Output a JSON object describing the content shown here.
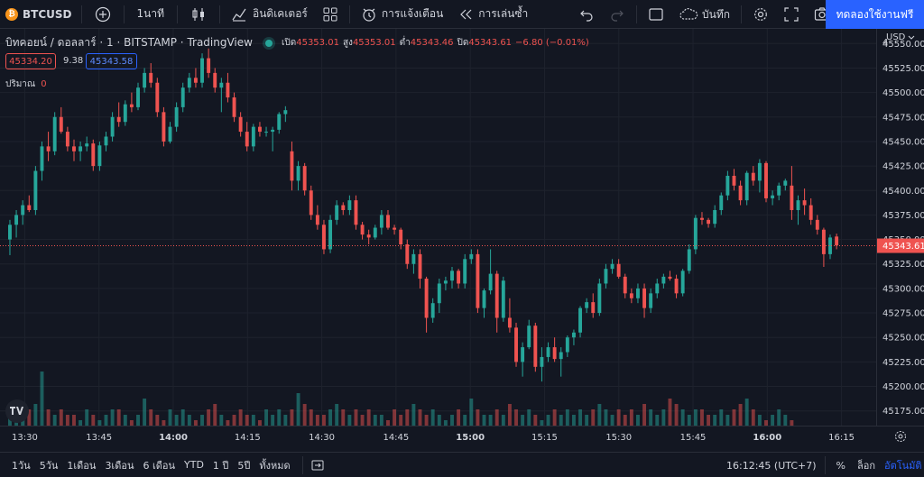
{
  "toolbar": {
    "symbol": "BTCUSD",
    "interval": "1นาที",
    "indicators_label": "อินดิเคเตอร์",
    "alerts_label": "การแจ้งเตือน",
    "replay_label": "การเล่นซ้ำ",
    "save_label": "บันทึก",
    "trial_button": "ทดลองใช้งานฟรี",
    "coin_glyph": "₿"
  },
  "legend": {
    "title": "บิทคอยน์ / ดอลลาร์ · 1 · BITSTAMP · TradingView",
    "open_label": "เปิด",
    "open": "45353.01",
    "high_label": "สูง",
    "high": "45353.01",
    "low_label": "ต่ำ",
    "low": "45343.46",
    "close_label": "ปิด",
    "close": "45343.61",
    "change": "−6.80 (−0.01%)",
    "bid": "45334.20",
    "spread": "9.38",
    "ask": "45343.58",
    "volume_label": "ปริมาณ",
    "volume_value": "0"
  },
  "price_axis": {
    "currency": "USD",
    "ticks": [
      "45550.00",
      "45525.00",
      "45500.00",
      "45475.00",
      "45450.00",
      "45425.00",
      "45400.00",
      "45375.00",
      "45350.00",
      "45325.00",
      "45300.00",
      "45275.00",
      "45250.00",
      "45225.00",
      "45200.00",
      "45175.00"
    ],
    "current_price": "45343.61",
    "top_partial": "4"
  },
  "time_axis": {
    "ticks": [
      "13:30",
      "13:45",
      "14:00",
      "14:15",
      "14:30",
      "14:45",
      "15:00",
      "15:15",
      "15:30",
      "15:45",
      "16:00",
      "16:15"
    ],
    "bold_ticks": [
      "14:00",
      "15:00",
      "16:00"
    ]
  },
  "bottom": {
    "ranges": [
      "1วัน",
      "5วัน",
      "1เดือน",
      "3เดือน",
      "6 เดือน",
      "YTD",
      "1 ปี",
      "5ปี",
      "ทั้งหมด"
    ],
    "clock": "16:12:45 (UTC+7)",
    "percent": "%",
    "log": "ล็อก",
    "auto": "อัตโนมัติ"
  },
  "colors": {
    "up": "#26a69a",
    "down": "#ef5350",
    "background": "#131722",
    "accent": "#2962ff"
  },
  "icons": [
    "plus-icon",
    "candles-icon",
    "indicators-icon",
    "templates-icon",
    "alert-icon",
    "replay-icon",
    "undo-icon",
    "redo-icon",
    "layout-icon",
    "cloud-icon",
    "gear-icon",
    "fullscreen-icon",
    "camera-icon",
    "goto-date-icon",
    "axis-settings-icon",
    "tradingview-logo"
  ],
  "chart_data": {
    "type": "candlestick",
    "x_range": [
      "13:25",
      "16:22"
    ],
    "ylim": [
      45160,
      45565
    ],
    "price_line": 45343.61,
    "candles": [
      [
        45350,
        45370,
        45334,
        45365
      ],
      [
        45365,
        45380,
        45352,
        45375
      ],
      [
        45375,
        45390,
        45365,
        45385
      ],
      [
        45385,
        45395,
        45378,
        45380
      ],
      [
        45380,
        45425,
        45375,
        45420
      ],
      [
        45420,
        45450,
        45410,
        45445
      ],
      [
        45445,
        45460,
        45430,
        45440
      ],
      [
        45440,
        45480,
        45436,
        45475
      ],
      [
        45475,
        45485,
        45458,
        45460
      ],
      [
        45460,
        45465,
        45440,
        45445
      ],
      [
        45445,
        45452,
        45430,
        45440
      ],
      [
        45440,
        45450,
        45430,
        45445
      ],
      [
        45445,
        45455,
        45440,
        45448
      ],
      [
        45448,
        45452,
        45420,
        45425
      ],
      [
        45425,
        45450,
        45420,
        45446
      ],
      [
        45446,
        45460,
        45440,
        45455
      ],
      [
        45455,
        45480,
        45450,
        45475
      ],
      [
        45475,
        45490,
        45465,
        45470
      ],
      [
        45470,
        45492,
        45466,
        45488
      ],
      [
        45488,
        45500,
        45480,
        45485
      ],
      [
        45485,
        45510,
        45482,
        45505
      ],
      [
        45505,
        45525,
        45500,
        45520
      ],
      [
        45520,
        45530,
        45505,
        45510
      ],
      [
        45510,
        45515,
        45475,
        45480
      ],
      [
        45480,
        45485,
        45445,
        45450
      ],
      [
        45450,
        45470,
        45448,
        45465
      ],
      [
        45465,
        45490,
        45460,
        45485
      ],
      [
        45485,
        45510,
        45480,
        45505
      ],
      [
        45505,
        45520,
        45500,
        45515
      ],
      [
        45515,
        45525,
        45505,
        45510
      ],
      [
        45510,
        45540,
        45505,
        45535
      ],
      [
        45535,
        45545,
        45515,
        45520
      ],
      [
        45520,
        45525,
        45500,
        45505
      ],
      [
        45505,
        45515,
        45480,
        45510
      ],
      [
        45510,
        45520,
        45490,
        45495
      ],
      [
        45495,
        45500,
        45470,
        45475
      ],
      [
        45475,
        45480,
        45455,
        45460
      ],
      [
        45460,
        45470,
        45440,
        45445
      ],
      [
        45445,
        45468,
        45440,
        45465
      ],
      [
        45465,
        45470,
        45455,
        45460
      ],
      [
        45460,
        45465,
        45455,
        45460
      ],
      [
        45460,
        45465,
        45440,
        45462
      ],
      [
        45462,
        45480,
        45458,
        45478
      ],
      [
        45478,
        45486,
        45470,
        45482
      ],
      [
        45440,
        45450,
        45400,
        45410
      ],
      [
        45410,
        45430,
        45400,
        45425
      ],
      [
        45425,
        45428,
        45395,
        45400
      ],
      [
        45400,
        45405,
        45370,
        45375
      ],
      [
        45375,
        45385,
        45360,
        45365
      ],
      [
        45365,
        45370,
        45335,
        45340
      ],
      [
        45340,
        45375,
        45336,
        45370
      ],
      [
        45370,
        45390,
        45365,
        45385
      ],
      [
        45385,
        45388,
        45375,
        45380
      ],
      [
        45380,
        45395,
        45375,
        45390
      ],
      [
        45390,
        45395,
        45360,
        45365
      ],
      [
        45365,
        45368,
        45350,
        45355
      ],
      [
        45355,
        45360,
        45345,
        45352
      ],
      [
        45352,
        45365,
        45350,
        45362
      ],
      [
        45362,
        45380,
        45355,
        45375
      ],
      [
        45375,
        45380,
        45360,
        45362
      ],
      [
        45362,
        45365,
        45355,
        45360
      ],
      [
        45360,
        45362,
        45340,
        45345
      ],
      [
        45345,
        45350,
        45320,
        45325
      ],
      [
        45325,
        45340,
        45315,
        45335
      ],
      [
        45335,
        45340,
        45300,
        45310
      ],
      [
        45310,
        45312,
        45255,
        45270
      ],
      [
        45270,
        45290,
        45265,
        45285
      ],
      [
        45285,
        45310,
        45275,
        45305
      ],
      [
        45305,
        45312,
        45298,
        45308
      ],
      [
        45308,
        45322,
        45300,
        45318
      ],
      [
        45318,
        45320,
        45300,
        45305
      ],
      [
        45305,
        45335,
        45300,
        45330
      ],
      [
        45330,
        45340,
        45325,
        45335
      ],
      [
        45335,
        45340,
        45275,
        45280
      ],
      [
        45280,
        45300,
        45270,
        45298
      ],
      [
        45298,
        45340,
        45294,
        45315
      ],
      [
        45315,
        45318,
        45255,
        45270
      ],
      [
        45270,
        45312,
        45266,
        45308
      ],
      [
        45270,
        45290,
        45255,
        45260
      ],
      [
        45260,
        45265,
        45220,
        45225
      ],
      [
        45225,
        45245,
        45210,
        45240
      ],
      [
        45240,
        45268,
        45238,
        45262
      ],
      [
        45262,
        45265,
        45215,
        45220
      ],
      [
        45220,
        45240,
        45205,
        45230
      ],
      [
        45230,
        45245,
        45225,
        45240
      ],
      [
        45240,
        45250,
        45225,
        45228
      ],
      [
        45228,
        45240,
        45210,
        45235
      ],
      [
        45235,
        45252,
        45230,
        45250
      ],
      [
        45250,
        45258,
        45242,
        45255
      ],
      [
        45255,
        45282,
        45250,
        45280
      ],
      [
        45280,
        45290,
        45275,
        45286
      ],
      [
        45286,
        45295,
        45270,
        45275
      ],
      [
        45275,
        45310,
        45272,
        45305
      ],
      [
        45305,
        45325,
        45300,
        45320
      ],
      [
        45320,
        45330,
        45315,
        45325
      ],
      [
        45325,
        45330,
        45310,
        45312
      ],
      [
        45312,
        45315,
        45290,
        45295
      ],
      [
        45295,
        45300,
        45285,
        45290
      ],
      [
        45290,
        45305,
        45285,
        45300
      ],
      [
        45300,
        45305,
        45270,
        45280
      ],
      [
        45280,
        45300,
        45275,
        45295
      ],
      [
        45295,
        45310,
        45290,
        45305
      ],
      [
        45305,
        45315,
        45300,
        45312
      ],
      [
        45312,
        45318,
        45308,
        45310
      ],
      [
        45310,
        45314,
        45290,
        45295
      ],
      [
        45295,
        45320,
        45292,
        45318
      ],
      [
        45318,
        45345,
        45315,
        45340
      ],
      [
        45340,
        45375,
        45335,
        45372
      ],
      [
        45372,
        45378,
        45365,
        45370
      ],
      [
        45370,
        45372,
        45362,
        45366
      ],
      [
        45366,
        45385,
        45362,
        45380
      ],
      [
        45380,
        45398,
        45375,
        45395
      ],
      [
        45395,
        45420,
        45390,
        45415
      ],
      [
        45415,
        45422,
        45400,
        45405
      ],
      [
        45405,
        45410,
        45385,
        45390
      ],
      [
        45390,
        45420,
        45385,
        45418
      ],
      [
        45418,
        45425,
        45405,
        45410
      ],
      [
        45410,
        45432,
        45398,
        45428
      ],
      [
        45428,
        45430,
        45388,
        45392
      ],
      [
        45392,
        45400,
        45385,
        45395
      ],
      [
        45395,
        45408,
        45390,
        45405
      ],
      [
        45405,
        45412,
        45400,
        45410
      ],
      [
        45405,
        45425,
        45370,
        45380
      ],
      [
        45380,
        45395,
        45365,
        45390
      ],
      [
        45390,
        45402,
        45375,
        45385
      ],
      [
        45385,
        45392,
        45365,
        45370
      ],
      [
        45370,
        45375,
        45355,
        45360
      ],
      [
        45360,
        45362,
        45322,
        45335
      ],
      [
        45335,
        45355,
        45330,
        45352
      ],
      [
        45353,
        45356,
        45340,
        45344
      ]
    ],
    "volume": [
      2,
      3,
      1,
      3,
      4,
      10,
      3,
      2,
      3,
      2,
      2,
      1,
      3,
      2,
      1,
      2,
      3,
      3,
      2,
      1,
      2,
      5,
      3,
      2,
      1,
      3,
      2,
      3,
      2,
      1,
      2,
      3,
      4,
      2,
      1,
      2,
      3,
      2,
      2,
      1,
      3,
      2,
      3,
      2,
      3,
      6,
      4,
      3,
      2,
      2,
      3,
      4,
      3,
      2,
      3,
      2,
      3,
      2,
      2,
      1,
      3,
      2,
      3,
      4,
      3,
      2,
      3,
      2,
      1,
      2,
      3,
      2,
      5,
      3,
      2,
      2,
      3,
      2,
      4,
      3,
      2,
      3,
      2,
      1,
      2,
      3,
      2,
      3,
      2,
      3,
      2,
      3,
      4,
      3,
      2,
      3,
      2,
      3,
      2,
      4,
      3,
      2,
      3,
      5,
      4,
      3,
      2,
      3,
      3,
      2,
      2,
      3,
      2,
      3,
      4,
      5,
      3,
      2,
      1,
      2,
      3,
      2,
      1
    ]
  }
}
